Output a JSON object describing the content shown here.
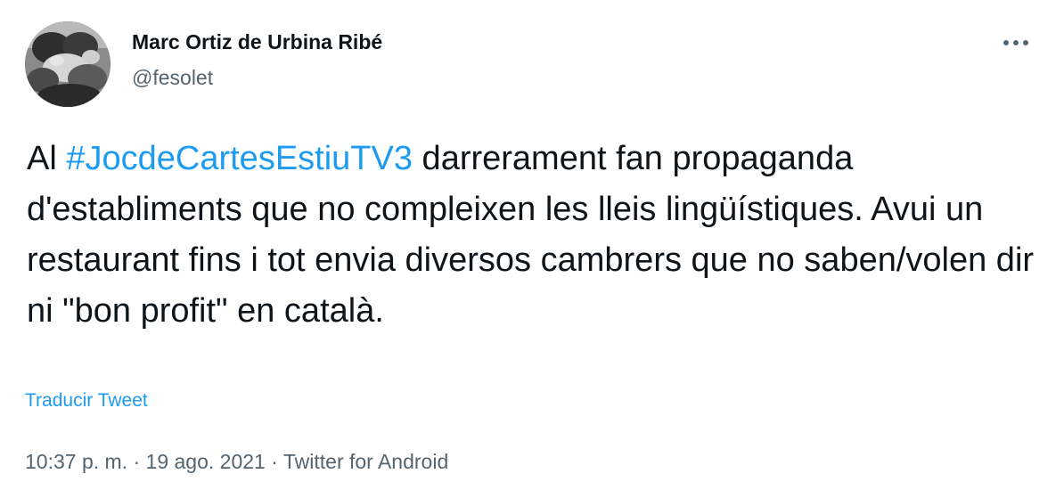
{
  "author": {
    "name": "Marc Ortiz de Urbina Ribé",
    "handle": "@fesolet",
    "avatar": "profile-photo-grayscale"
  },
  "more_icon": "more-horizontal-icon",
  "tweet": {
    "prefix": "Al ",
    "hashtag": "#JocdeCartesEstiuTV3",
    "body": " darrerament fan propaganda d'establiments que no compleixen les lleis lingüístiques. Avui un restaurant fins i tot envia diversos cambrers que no saben/volen dir ni \"bon profit\" en català."
  },
  "translate_label": "Traducir Tweet",
  "meta": {
    "time": "10:37 p. m.",
    "separator": "·",
    "date": "19 ago. 2021",
    "source": "Twitter for Android"
  },
  "colors": {
    "link": "#1d9bf0",
    "text": "#0f1419",
    "secondary": "#536471"
  }
}
